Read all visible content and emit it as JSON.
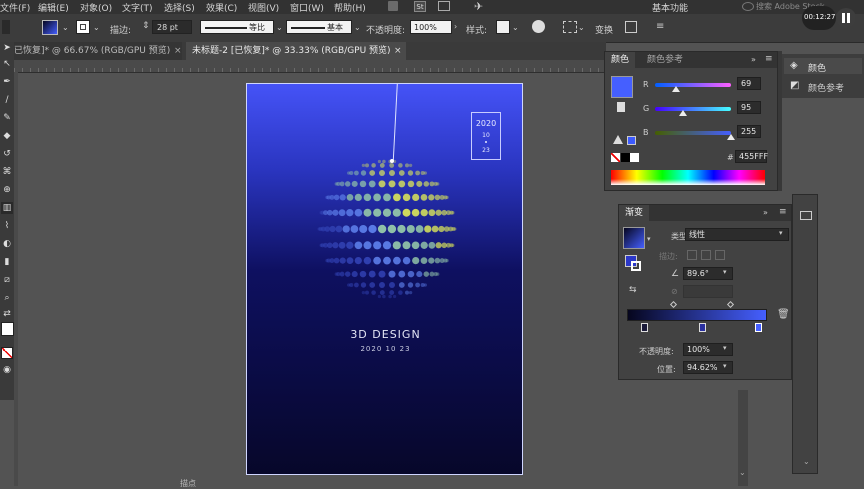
{
  "menu": {
    "items": [
      "文件(F)",
      "编辑(E)",
      "对象(O)",
      "文字(T)",
      "选择(S)",
      "效果(C)",
      "视图(V)",
      "窗口(W)",
      "帮助(H)"
    ],
    "bridge_label": "St",
    "workspace": "基本功能",
    "search_placeholder": "搜索 Adobe Stock"
  },
  "recording": {
    "timer": "00:12:27"
  },
  "control_bar": {
    "stroke_label": "描边:",
    "stroke_value": "28 pt",
    "profile_label": "等比",
    "brush_label": "基本",
    "opacity_label": "不透明度:",
    "opacity_value": "100%",
    "style_label": "样式:",
    "transform_label": "变换"
  },
  "tabs": [
    {
      "label": "已恢复]* @ 66.67% (RGB/GPU 预览)"
    },
    {
      "label": "未标题-2 [已恢复]* @ 33.33% (RGB/GPU 预览)"
    }
  ],
  "artboard": {
    "year": "2020",
    "month": "10",
    "day": "23",
    "title": "3D DESIGN",
    "date": "2020 10 23"
  },
  "color_panel": {
    "tab_active": "颜色",
    "tab_inactive": "颜色参考",
    "r_label": "R",
    "g_label": "G",
    "b_label": "B",
    "r_value": 69,
    "g_value": 95,
    "b_value": 255,
    "hex_label": "#",
    "hex_value": "455FFF",
    "swatch_color": "#455FFF"
  },
  "gradient_panel": {
    "tab": "渐变",
    "type_label": "类型:",
    "type_value": "线性",
    "stroke_label": "描边:",
    "angle_value": "89.6°",
    "opacity_label": "不透明度:",
    "opacity_value": "100%",
    "location_label": "位置:",
    "location_value": "94.62%",
    "start_color": "#06061e",
    "end_color": "#455FFF"
  },
  "right_dock": {
    "items": [
      "颜色",
      "颜色参考"
    ]
  },
  "status": {
    "fragment": "描点"
  }
}
